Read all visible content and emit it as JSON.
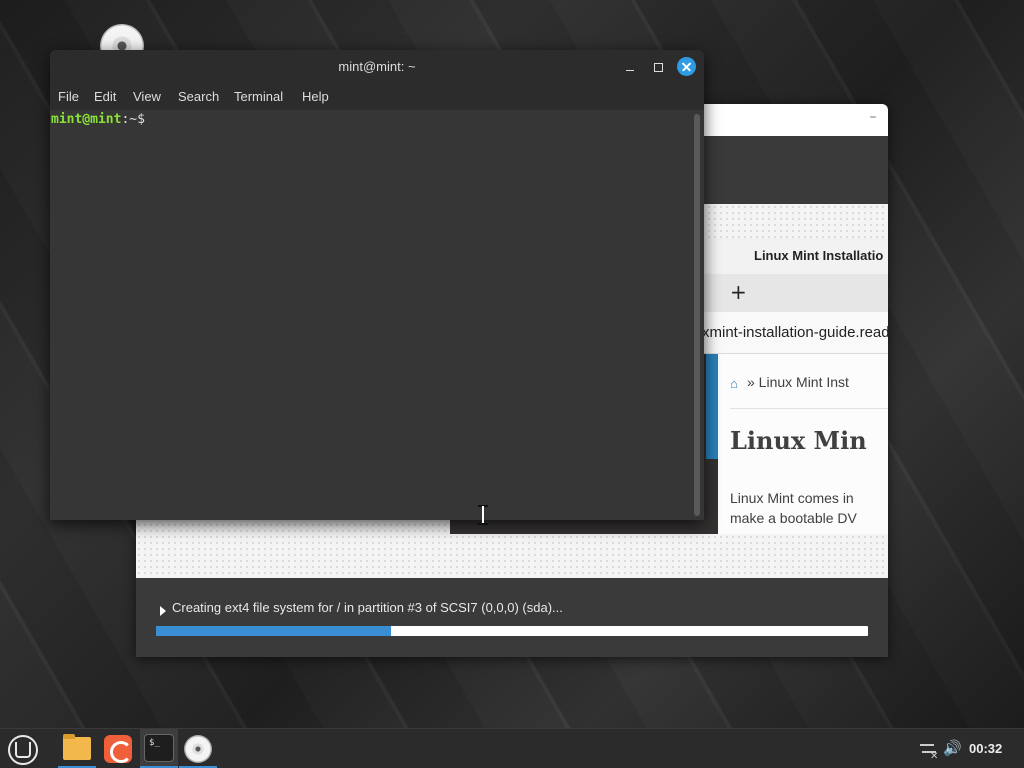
{
  "terminal": {
    "title": "mint@mint: ~",
    "menu": [
      "File",
      "Edit",
      "View",
      "Search",
      "Terminal",
      "Help"
    ],
    "prompt_user": "mint@mint",
    "prompt_path": ":~$"
  },
  "installer": {
    "minimize_glyph": "–",
    "slide": {
      "browser_title": "Linux Mint Installatio",
      "new_tab_glyph": "+",
      "url": "xmint-installation-guide.read",
      "breadcrumb": "» Linux Mint Inst",
      "heading": "Linux Min",
      "paragraph": "Linux Mint comes in\nmake a bootable DV"
    },
    "status_text": "Creating ext4 file system for / in partition #3 of SCSI7 (0,0,0) (sda)...",
    "progress_percent": 33
  },
  "taskbar": {
    "terminal_icon_text": "$_",
    "volume_glyph": "🔊",
    "clock": "00:32"
  },
  "colors": {
    "accent": "#3a8fd4",
    "prompt_green": "#8ae234"
  }
}
